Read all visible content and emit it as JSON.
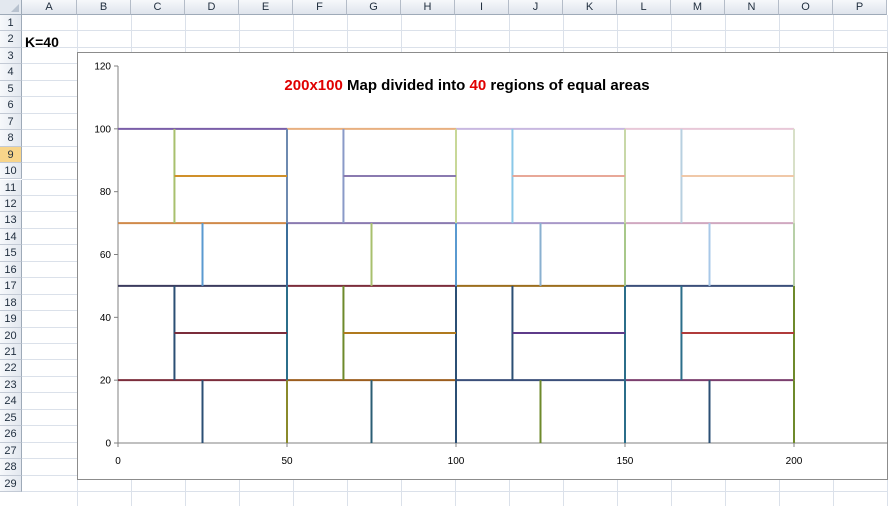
{
  "sheet": {
    "columns": [
      "A",
      "B",
      "C",
      "D",
      "E",
      "F",
      "G",
      "H",
      "I",
      "J",
      "K",
      "L",
      "M",
      "N",
      "O",
      "P"
    ],
    "rows": [
      "1",
      "2",
      "3",
      "4",
      "5",
      "6",
      "7",
      "8",
      "9",
      "10",
      "11",
      "12",
      "13",
      "14",
      "15",
      "16",
      "17",
      "18",
      "19",
      "20",
      "21",
      "22",
      "23",
      "24",
      "25",
      "26",
      "27",
      "28",
      "29"
    ],
    "selected_row": "9",
    "cell_a2": "K=40"
  },
  "chart": {
    "title_parts": [
      {
        "text": "200x100",
        "color": "#e00000"
      },
      {
        "text": " Map divided into ",
        "color": "#000000"
      },
      {
        "text": "40",
        "color": "#e00000"
      },
      {
        "text": " regions of equal areas",
        "color": "#000000"
      }
    ]
  },
  "chart_data": {
    "type": "scatter",
    "title": "200x100 Map divided into 40 regions of equal areas",
    "xlim": [
      0,
      200
    ],
    "ylim": [
      0,
      120
    ],
    "x_ticks": [
      0,
      50,
      100,
      150,
      200
    ],
    "y_ticks": [
      0,
      20,
      40,
      60,
      80,
      100,
      120
    ],
    "grid": false,
    "segments": [
      {
        "x1": 0,
        "y1": 20,
        "x2": 50,
        "y2": 20,
        "color": "#7b2d3b"
      },
      {
        "x1": 50,
        "y1": 20,
        "x2": 100,
        "y2": 20,
        "color": "#9c5e1e"
      },
      {
        "x1": 100,
        "y1": 20,
        "x2": 150,
        "y2": 20,
        "color": "#3b4f7a"
      },
      {
        "x1": 150,
        "y1": 20,
        "x2": 200,
        "y2": 20,
        "color": "#7b3f6e"
      },
      {
        "x1": 25,
        "y1": 0,
        "x2": 25,
        "y2": 20,
        "color": "#2b4f74"
      },
      {
        "x1": 50,
        "y1": 0,
        "x2": 50,
        "y2": 20,
        "color": "#8a8a2b"
      },
      {
        "x1": 75,
        "y1": 0,
        "x2": 75,
        "y2": 20,
        "color": "#2b5e74"
      },
      {
        "x1": 100,
        "y1": 0,
        "x2": 100,
        "y2": 20,
        "color": "#2b4f74"
      },
      {
        "x1": 125,
        "y1": 0,
        "x2": 125,
        "y2": 20,
        "color": "#6e8a2b"
      },
      {
        "x1": 150,
        "y1": 0,
        "x2": 150,
        "y2": 20,
        "color": "#2b6e8a"
      },
      {
        "x1": 175,
        "y1": 0,
        "x2": 175,
        "y2": 20,
        "color": "#2b4f74"
      },
      {
        "x1": 200,
        "y1": 0,
        "x2": 200,
        "y2": 20,
        "color": "#6e8a2b"
      },
      {
        "x1": 0,
        "y1": 50,
        "x2": 50,
        "y2": 50,
        "color": "#3b3b5e"
      },
      {
        "x1": 50,
        "y1": 50,
        "x2": 100,
        "y2": 50,
        "color": "#7b2d3b"
      },
      {
        "x1": 100,
        "y1": 50,
        "x2": 150,
        "y2": 50,
        "color": "#9c6e1e"
      },
      {
        "x1": 150,
        "y1": 50,
        "x2": 200,
        "y2": 50,
        "color": "#3b4f7a"
      },
      {
        "x1": 16.7,
        "y1": 20,
        "x2": 16.7,
        "y2": 50,
        "color": "#2b4f74"
      },
      {
        "x1": 50,
        "y1": 20,
        "x2": 50,
        "y2": 50,
        "color": "#2b6e8a"
      },
      {
        "x1": 66.7,
        "y1": 20,
        "x2": 66.7,
        "y2": 50,
        "color": "#6e8a2b"
      },
      {
        "x1": 100,
        "y1": 20,
        "x2": 100,
        "y2": 50,
        "color": "#2b4f74"
      },
      {
        "x1": 116.7,
        "y1": 20,
        "x2": 116.7,
        "y2": 50,
        "color": "#2b4f74"
      },
      {
        "x1": 150,
        "y1": 20,
        "x2": 150,
        "y2": 50,
        "color": "#2b6e8a"
      },
      {
        "x1": 166.7,
        "y1": 20,
        "x2": 166.7,
        "y2": 50,
        "color": "#2b6e8a"
      },
      {
        "x1": 200,
        "y1": 20,
        "x2": 200,
        "y2": 50,
        "color": "#6e8a2b"
      },
      {
        "x1": 16.7,
        "y1": 35,
        "x2": 50,
        "y2": 35,
        "color": "#7b2d3b"
      },
      {
        "x1": 66.7,
        "y1": 35,
        "x2": 100,
        "y2": 35,
        "color": "#b07a1e"
      },
      {
        "x1": 116.7,
        "y1": 35,
        "x2": 150,
        "y2": 35,
        "color": "#5e3b8a"
      },
      {
        "x1": 166.7,
        "y1": 35,
        "x2": 200,
        "y2": 35,
        "color": "#b03b3b"
      },
      {
        "x1": 0,
        "y1": 70,
        "x2": 50,
        "y2": 70,
        "color": "#d08a4a"
      },
      {
        "x1": 50,
        "y1": 70,
        "x2": 100,
        "y2": 70,
        "color": "#8a7ab0"
      },
      {
        "x1": 100,
        "y1": 70,
        "x2": 150,
        "y2": 70,
        "color": "#a898c8"
      },
      {
        "x1": 150,
        "y1": 70,
        "x2": 200,
        "y2": 70,
        "color": "#d0a8c0"
      },
      {
        "x1": 25,
        "y1": 50,
        "x2": 25,
        "y2": 70,
        "color": "#5a9ad0"
      },
      {
        "x1": 50,
        "y1": 50,
        "x2": 50,
        "y2": 70,
        "color": "#3b6e9a"
      },
      {
        "x1": 75,
        "y1": 50,
        "x2": 75,
        "y2": 70,
        "color": "#a8c06e"
      },
      {
        "x1": 100,
        "y1": 50,
        "x2": 100,
        "y2": 70,
        "color": "#5a9ad0"
      },
      {
        "x1": 125,
        "y1": 50,
        "x2": 125,
        "y2": 70,
        "color": "#8ab0d0"
      },
      {
        "x1": 150,
        "y1": 50,
        "x2": 150,
        "y2": 70,
        "color": "#a8c88a"
      },
      {
        "x1": 175,
        "y1": 50,
        "x2": 175,
        "y2": 70,
        "color": "#a8c8e8"
      },
      {
        "x1": 200,
        "y1": 50,
        "x2": 200,
        "y2": 70,
        "color": "#b8d0a8"
      },
      {
        "x1": 0,
        "y1": 100,
        "x2": 50,
        "y2": 100,
        "color": "#7a5ea8"
      },
      {
        "x1": 50,
        "y1": 100,
        "x2": 100,
        "y2": 100,
        "color": "#e8b080"
      },
      {
        "x1": 100,
        "y1": 100,
        "x2": 150,
        "y2": 100,
        "color": "#c8b8e0"
      },
      {
        "x1": 150,
        "y1": 100,
        "x2": 200,
        "y2": 100,
        "color": "#e8c8d8"
      },
      {
        "x1": 16.7,
        "y1": 70,
        "x2": 16.7,
        "y2": 100,
        "color": "#a8c06e"
      },
      {
        "x1": 50,
        "y1": 70,
        "x2": 50,
        "y2": 100,
        "color": "#6e8ab0"
      },
      {
        "x1": 66.7,
        "y1": 70,
        "x2": 66.7,
        "y2": 100,
        "color": "#8a9ac8"
      },
      {
        "x1": 100,
        "y1": 70,
        "x2": 100,
        "y2": 100,
        "color": "#c8d898"
      },
      {
        "x1": 116.7,
        "y1": 70,
        "x2": 116.7,
        "y2": 100,
        "color": "#8ac8e8"
      },
      {
        "x1": 150,
        "y1": 70,
        "x2": 150,
        "y2": 100,
        "color": "#c8d8a8"
      },
      {
        "x1": 166.7,
        "y1": 70,
        "x2": 166.7,
        "y2": 100,
        "color": "#b8d0e0"
      },
      {
        "x1": 200,
        "y1": 70,
        "x2": 200,
        "y2": 100,
        "color": "#d8e0c8"
      },
      {
        "x1": 16.7,
        "y1": 85,
        "x2": 50,
        "y2": 85,
        "color": "#d0902a"
      },
      {
        "x1": 66.7,
        "y1": 85,
        "x2": 100,
        "y2": 85,
        "color": "#8a7ab0"
      },
      {
        "x1": 116.7,
        "y1": 85,
        "x2": 150,
        "y2": 85,
        "color": "#e8a898"
      },
      {
        "x1": 166.7,
        "y1": 85,
        "x2": 200,
        "y2": 85,
        "color": "#f0c8a8"
      }
    ]
  }
}
